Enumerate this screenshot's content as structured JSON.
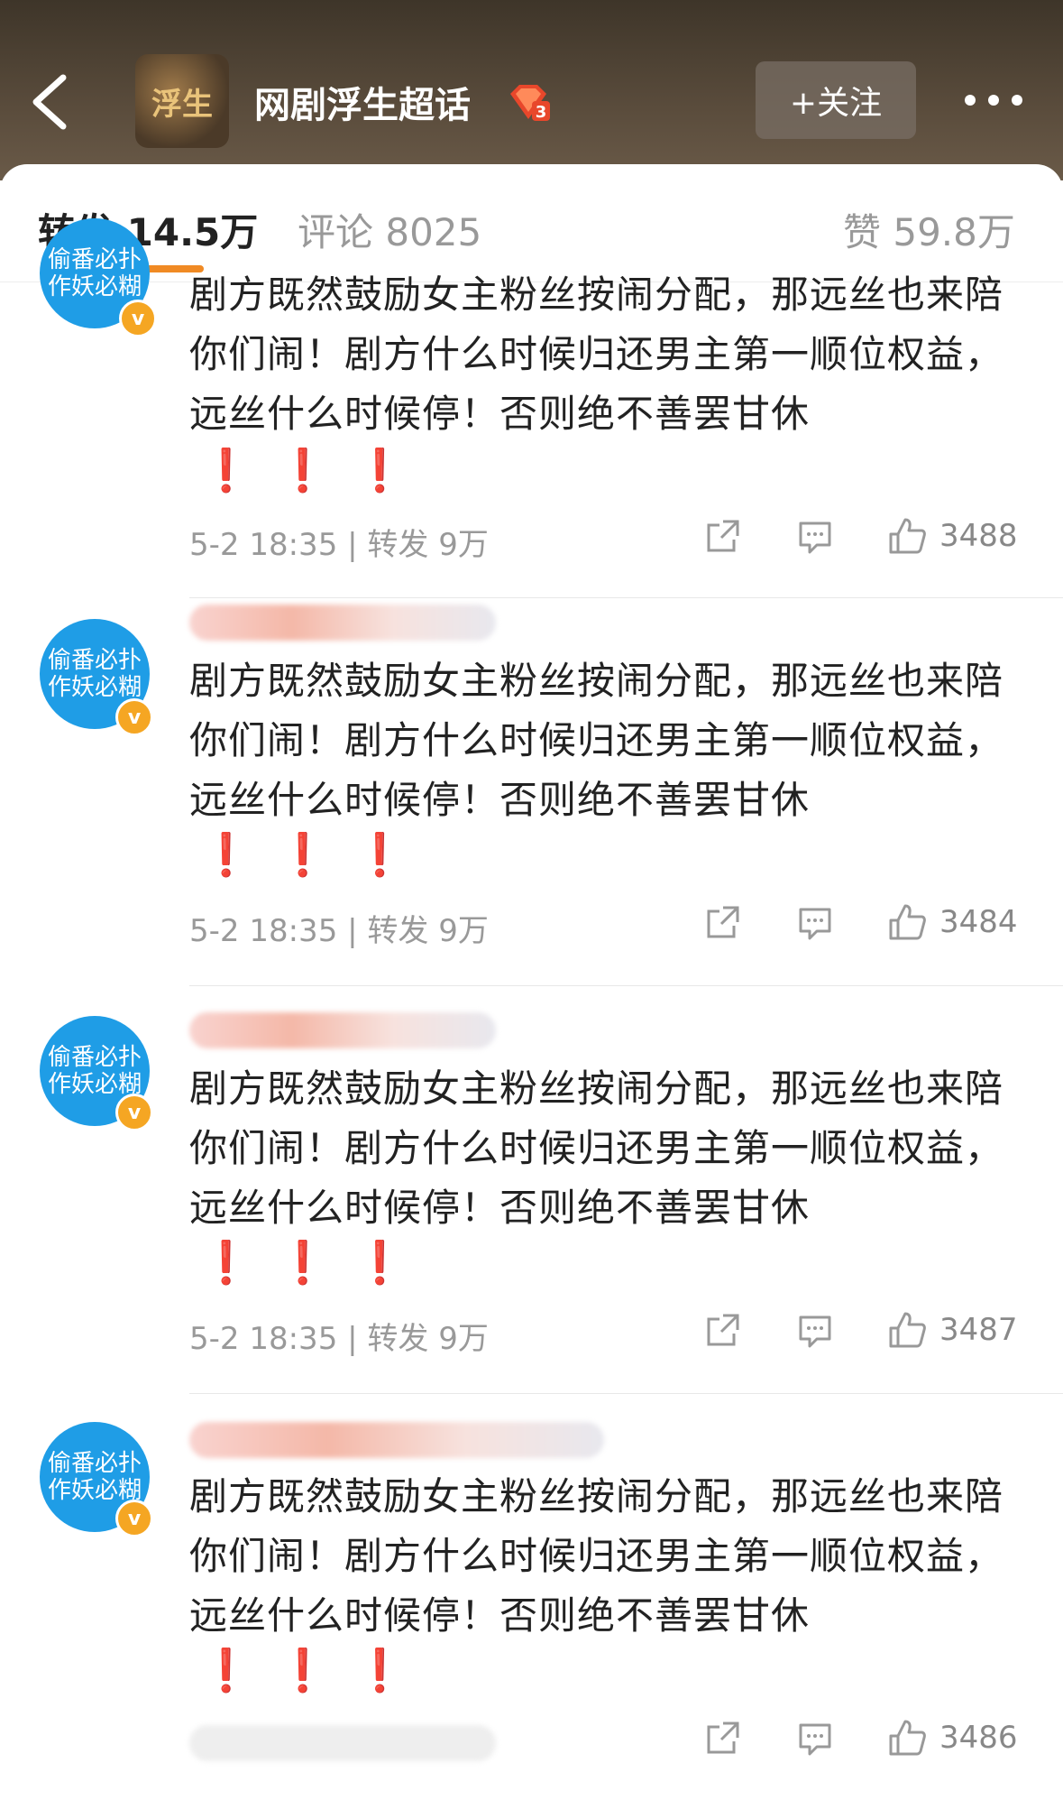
{
  "header": {
    "topic_avatar_text": "浮生",
    "title": "网剧浮生超话",
    "badge_level": "3",
    "follow_label": "+关注"
  },
  "tabs": [
    {
      "label": "转发 14.5万",
      "active": true
    },
    {
      "label": "评论 8025",
      "active": false
    },
    {
      "label": "赞 59.8万",
      "active": false
    }
  ],
  "comments": [
    {
      "avatar_lines": [
        "偷番必扑",
        "作妖必糊"
      ],
      "text": "剧方既然鼓励女主粉丝按闹分配，那远丝也来陪你们闹！剧方什么时候归还男主第一顺位权益，远丝什么时候停！否则绝不善罢甘休",
      "bangs": "❗❗❗",
      "meta": "5-2 18:35 | 转发 9万",
      "likes": "3488"
    },
    {
      "avatar_lines": [
        "偷番必扑",
        "作妖必糊"
      ],
      "text": "剧方既然鼓励女主粉丝按闹分配，那远丝也来陪你们闹！剧方什么时候归还男主第一顺位权益，远丝什么时候停！否则绝不善罢甘休",
      "bangs": "❗❗❗",
      "meta": "5-2 18:35 | 转发 9万",
      "likes": "3484"
    },
    {
      "avatar_lines": [
        "偷番必扑",
        "作妖必糊"
      ],
      "text": "剧方既然鼓励女主粉丝按闹分配，那远丝也来陪你们闹！剧方什么时候归还男主第一顺位权益，远丝什么时候停！否则绝不善罢甘休",
      "bangs": "❗❗❗",
      "meta": "5-2 18:35 | 转发 9万",
      "likes": "3487"
    },
    {
      "avatar_lines": [
        "偷番必扑",
        "作妖必糊"
      ],
      "text": "剧方既然鼓励女主粉丝按闹分配，那远丝也来陪你们闹！剧方什么时候归还男主第一顺位权益，远丝什么时候停！否则绝不善罢甘休",
      "bangs": "❗❗❗",
      "meta": "",
      "likes": "3486"
    }
  ],
  "colors": {
    "accent": "#f08a24",
    "avatar_bg": "#1f9de6",
    "verified": "#f5a623",
    "exclaim": "#e02020"
  },
  "icons": [
    "back-arrow-icon",
    "diamond-badge-icon",
    "more-dots-icon",
    "share-icon",
    "comment-icon",
    "like-icon"
  ]
}
